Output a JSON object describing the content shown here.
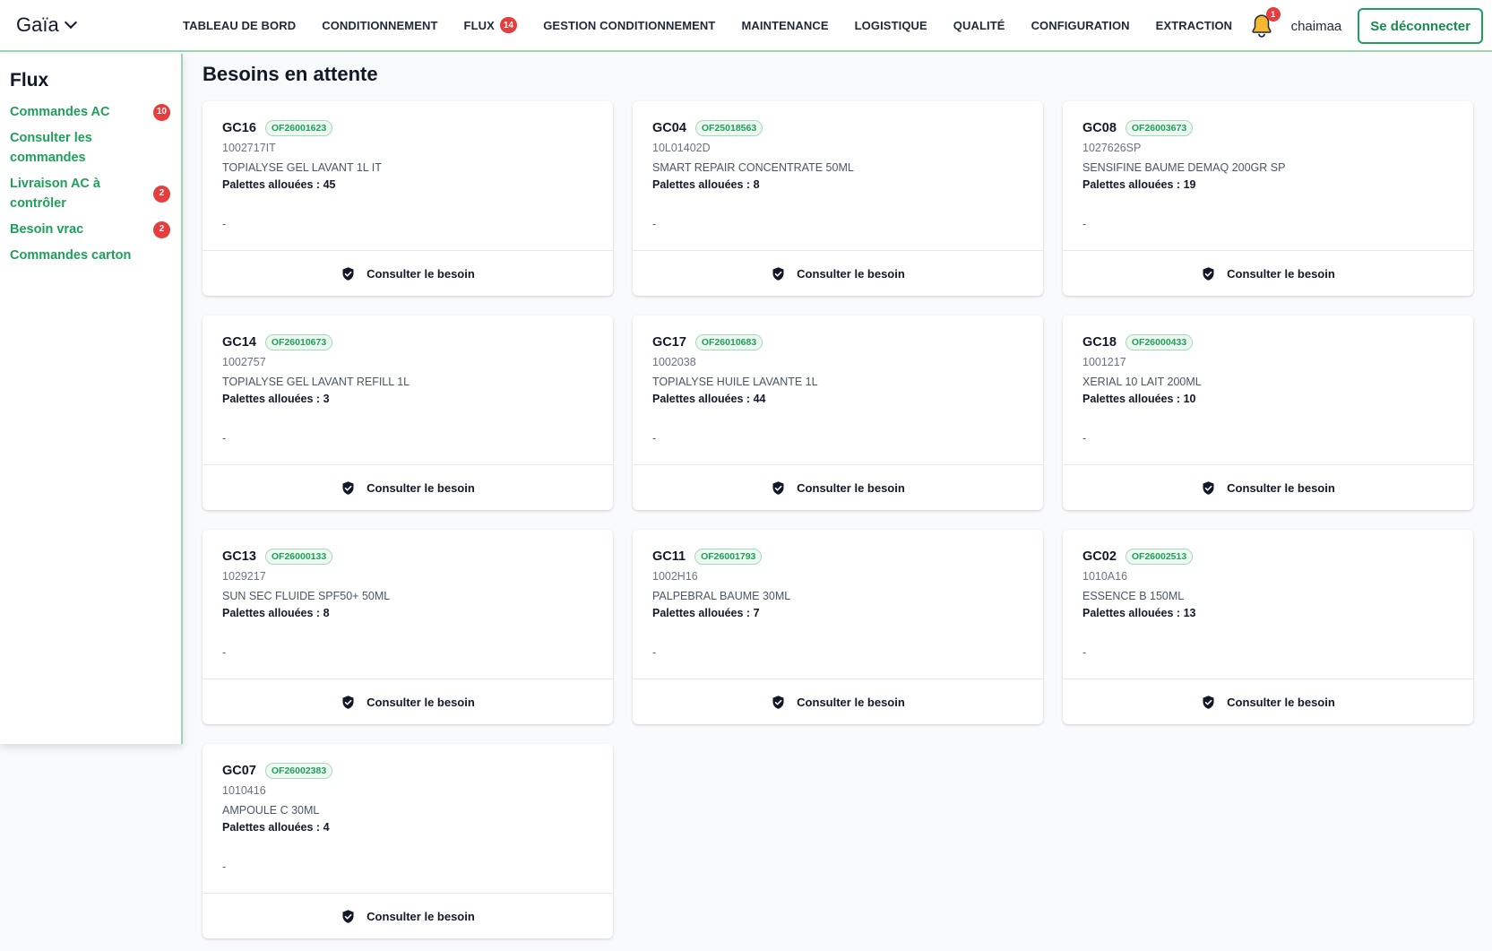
{
  "brand": "Gaïa",
  "nav": [
    {
      "label": "TABLEAU DE BORD"
    },
    {
      "label": "CONDITIONNEMENT"
    },
    {
      "label": "FLUX",
      "badge": "14"
    },
    {
      "label": "GESTION CONDITIONNEMENT"
    },
    {
      "label": "MAINTENANCE"
    },
    {
      "label": "LOGISTIQUE"
    },
    {
      "label": "QUALITÉ"
    },
    {
      "label": "CONFIGURATION"
    },
    {
      "label": "EXTRACTION"
    }
  ],
  "header": {
    "notification_count": "1",
    "username": "chaimaa",
    "logout_label": "Se déconnecter"
  },
  "sidebar": {
    "title": "Flux",
    "items": [
      {
        "label": "Commandes AC",
        "badge": "10"
      },
      {
        "label": "Consulter les commandes",
        "badge": ""
      },
      {
        "label": "Livraison AC à contrôler",
        "badge": "2"
      },
      {
        "label": "Besoin vrac",
        "badge": "2"
      },
      {
        "label": "Commandes carton",
        "badge": ""
      }
    ]
  },
  "main": {
    "title": "Besoins en attente",
    "action_label": "Consulter le besoin",
    "pallets_prefix": "Palettes allouées : ",
    "cards": [
      {
        "machine": "GC16",
        "of": "OF26001623",
        "code": "1002717IT",
        "product": "TOPIALYSE GEL LAVANT 1L IT",
        "pallets": "45",
        "note": "-"
      },
      {
        "machine": "GC04",
        "of": "OF25018563",
        "code": "10L01402D",
        "product": "SMART REPAIR CONCENTRATE 50ML",
        "pallets": "8",
        "note": "-"
      },
      {
        "machine": "GC08",
        "of": "OF26003673",
        "code": "1027626SP",
        "product": "SENSIFINE BAUME DEMAQ 200GR SP",
        "pallets": "19",
        "note": "-"
      },
      {
        "machine": "GC14",
        "of": "OF26010673",
        "code": "1002757",
        "product": "TOPIALYSE GEL LAVANT REFILL 1L",
        "pallets": "3",
        "note": "-"
      },
      {
        "machine": "GC17",
        "of": "OF26010683",
        "code": "1002038",
        "product": "TOPIALYSE HUILE LAVANTE 1L",
        "pallets": "44",
        "note": "-"
      },
      {
        "machine": "GC18",
        "of": "OF26000433",
        "code": "1001217",
        "product": "XERIAL 10 LAIT 200ML",
        "pallets": "10",
        "note": "-"
      },
      {
        "machine": "GC13",
        "of": "OF26000133",
        "code": "1029217",
        "product": "SUN SEC FLUIDE SPF50+ 50ML",
        "pallets": "8",
        "note": "-"
      },
      {
        "machine": "GC11",
        "of": "OF26001793",
        "code": "1002H16",
        "product": "PALPEBRAL BAUME 30ML",
        "pallets": "7",
        "note": "-"
      },
      {
        "machine": "GC02",
        "of": "OF26002513",
        "code": "1010A16",
        "product": "ESSENCE B 150ML",
        "pallets": "13",
        "note": "-"
      },
      {
        "machine": "GC07",
        "of": "OF26002383",
        "code": "1010416",
        "product": "AMPOULE C 30ML",
        "pallets": "4",
        "note": "-"
      }
    ]
  },
  "colors": {
    "accent_green": "#1e9f5a",
    "badge_red": "#e53e3e",
    "bell_yellow": "#f5b82e"
  },
  "icons": {
    "brand_chevron": "chevron-down-icon",
    "notification": "bell-icon",
    "card_action": "shield-check-icon"
  }
}
